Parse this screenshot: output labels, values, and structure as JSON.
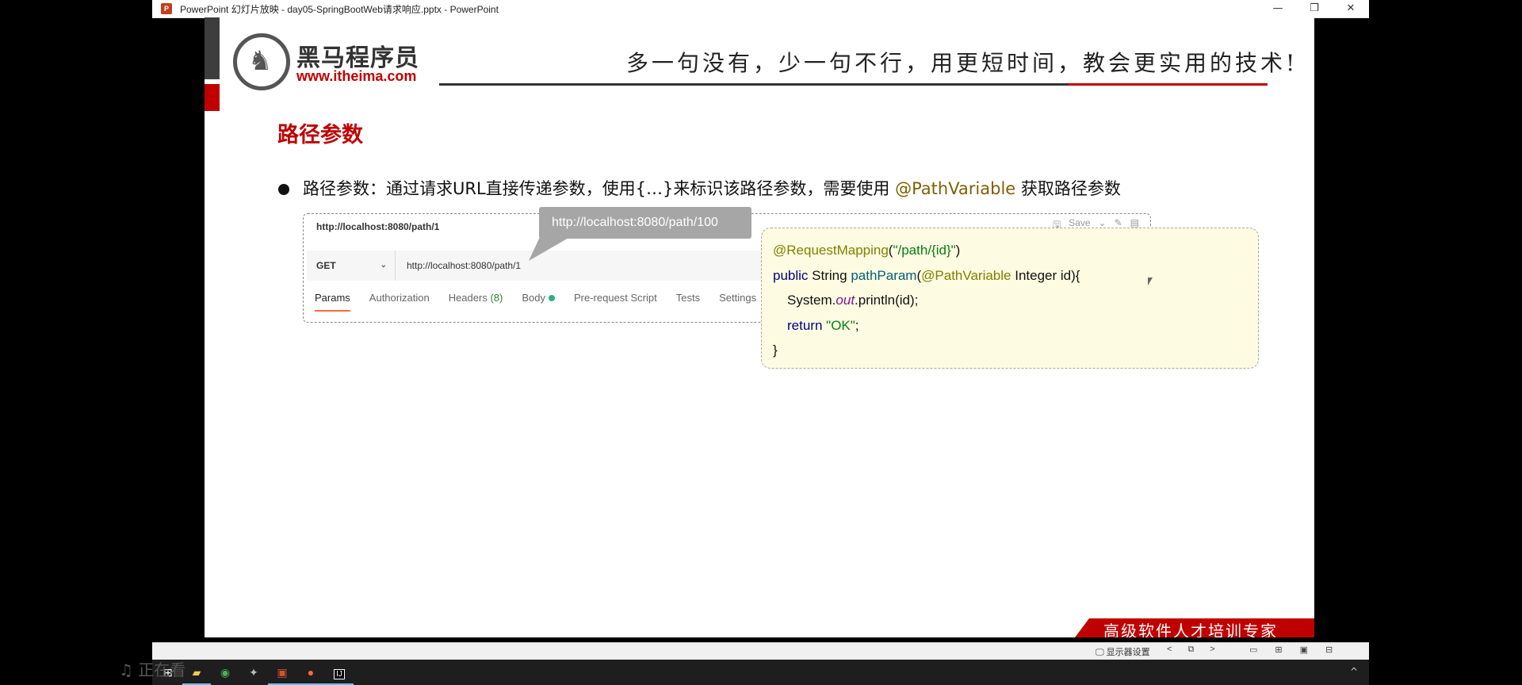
{
  "window": {
    "title": "PowerPoint 幻灯片放映  -  day05-SpringBootWeb请求响应.pptx - PowerPoint",
    "app_icon": "P",
    "controls": [
      "—",
      "❐",
      "✕"
    ]
  },
  "slide": {
    "logo": {
      "cn": "黑马程序员",
      "url": "www.itheima.com"
    },
    "slogan": "多一句没有，少一句不行，用更短时间，教会更实用的技术!",
    "title": "路径参数",
    "bullet": {
      "before": "路径参数：通过请求URL直接传递参数，使用{…}来标识该路径参数，需要使用 ",
      "highlight": "@PathVariable",
      "after": " 获取路径参数"
    },
    "postman": {
      "tab_url": "http://localhost:8080/path/1",
      "save_label": "Save",
      "method": "GET",
      "request_url": "http://localhost:8080/path/1",
      "tabs": [
        {
          "label": "Params",
          "count": ""
        },
        {
          "label": "Authorization",
          "count": ""
        },
        {
          "label": "Headers",
          "count": "(8)"
        },
        {
          "label": "Body",
          "count": ""
        },
        {
          "label": "Pre-request Script",
          "count": ""
        },
        {
          "label": "Tests",
          "count": ""
        },
        {
          "label": "Settings",
          "count": ""
        }
      ]
    },
    "tooltip": "http://localhost:8080/path/100",
    "code": {
      "line1_ann": "@RequestMapping",
      "line1_str": "\"/path/{id}\"",
      "line2_kw": "public",
      "line2_type": "String",
      "line2_fn": "pathParam",
      "line2_ann": "@PathVariable",
      "line2_rest": "Integer id){",
      "line3_pre": "System.",
      "line3_it": "out",
      "line3_post": ".println(id);",
      "line4_kw": "return",
      "line4_str": "\"OK\"",
      "line5": "}"
    },
    "banner": "高级软件人才培训专家"
  },
  "statusbar": {
    "display_settings": "显示器设置",
    "nav": [
      "<",
      "⧉",
      ">"
    ],
    "views": [
      "▭",
      "⊞",
      "▣",
      "⊟"
    ]
  },
  "taskbar": {
    "items": [
      "windows-start-icon",
      "file-explorer-icon",
      "chrome-icon",
      "app-icon",
      "powerpoint-icon",
      "postman-icon",
      "intellij-icon"
    ],
    "tray_up": "^"
  },
  "watermark": "正在看"
}
